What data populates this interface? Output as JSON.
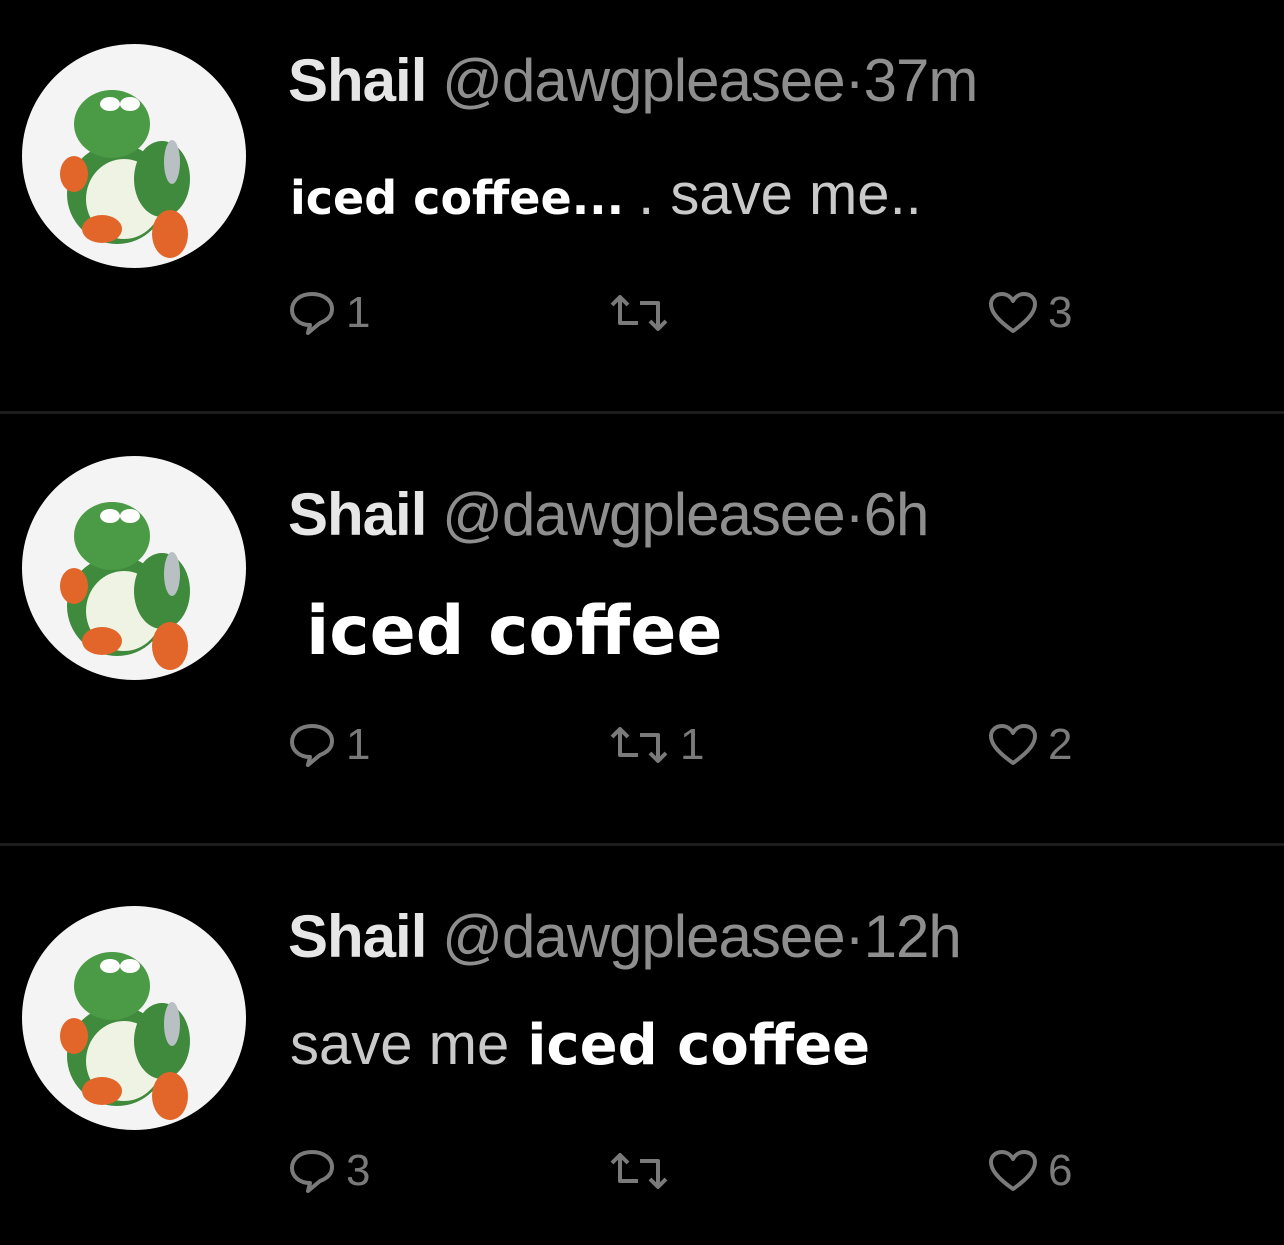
{
  "tweets": [
    {
      "author": "Shail",
      "handle": "@dawgpleasee",
      "separator": "·",
      "time": "37m",
      "text_overlay": "iced coffee...",
      "text_faint": ". save me..",
      "replies": "1",
      "retweets": "",
      "likes": "3"
    },
    {
      "author": "Shail",
      "handle": "@dawgpleasee",
      "separator": "·",
      "time": "6h",
      "text_overlay": "iced coffee",
      "replies": "1",
      "retweets": "1",
      "likes": "2"
    },
    {
      "author": "Shail",
      "handle": "@dawgpleasee",
      "separator": "·",
      "time": "12h",
      "text_faint": "save me",
      "text_overlay": "iced coffee",
      "replies": "3",
      "retweets": "",
      "likes": "6"
    }
  ],
  "icons": {
    "reply": "speech-bubble-icon",
    "retweet": "retweet-arrows-icon",
    "like": "heart-icon",
    "avatar": "green-dinosaur-avatar"
  },
  "colors": {
    "background": "#000000",
    "name": "#e6e6e6",
    "meta": "#8e8e8e",
    "overlay_text": "#ffffff",
    "icon": "#7a7a7a"
  }
}
